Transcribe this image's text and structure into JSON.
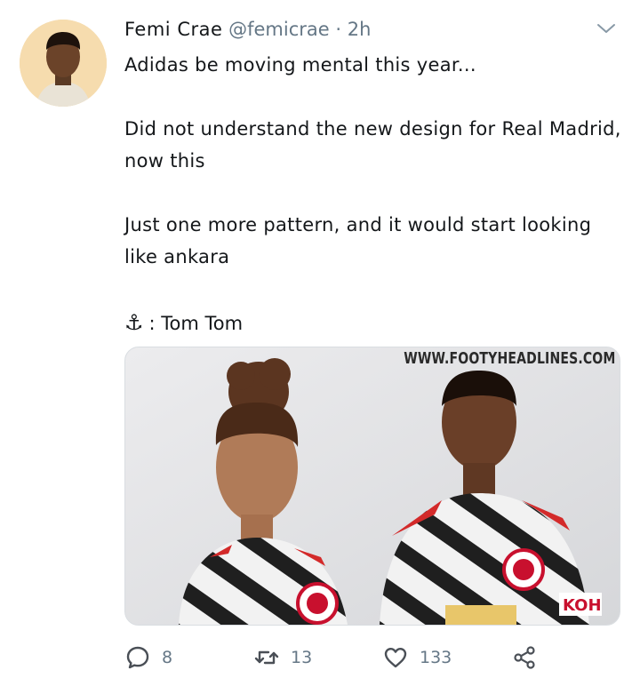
{
  "tweet": {
    "author_name": "Femi Crae",
    "handle": "@femicrae",
    "separator": "·",
    "time": "2h",
    "text": "Adidas be moving mental this year...\n\nDid not understand the new design for Real Madrid, now this\n\nJust one more pattern, and it would start looking like ankara",
    "credit_icon": "⚓",
    "credit": ": Tom Tom"
  },
  "media": {
    "watermark": "WWW.FOOTYHEADLINES.COM"
  },
  "actions": {
    "replies": "8",
    "retweets": "13",
    "likes": "133"
  }
}
